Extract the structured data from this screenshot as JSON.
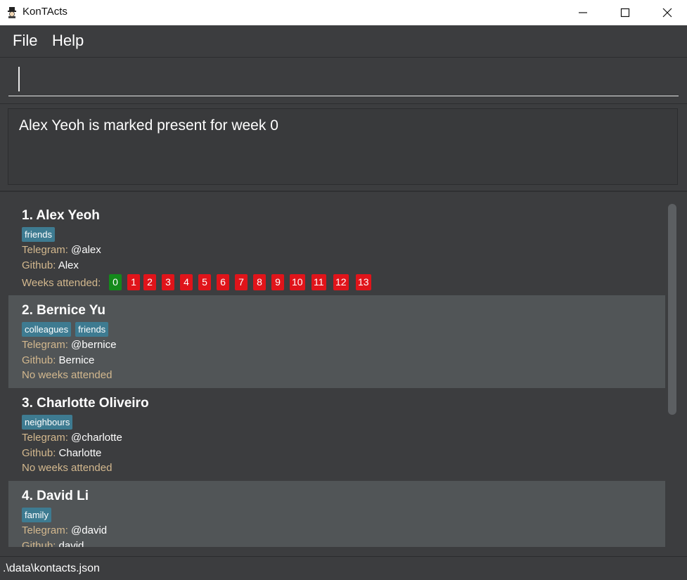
{
  "window": {
    "title": "KonTActs"
  },
  "menu": {
    "file": "File",
    "help": "Help"
  },
  "command": {
    "value": ""
  },
  "result": {
    "text": "Alex Yeoh is marked present for week 0"
  },
  "labels": {
    "telegram": "Telegram: ",
    "github": "Github: ",
    "weeks": "Weeks attended:",
    "no_weeks": "No weeks attended"
  },
  "persons": [
    {
      "name": "1. Alex Yeoh",
      "tags": [
        "friends"
      ],
      "telegram": "@alex",
      "github": "Alex",
      "weeks": [
        {
          "w": "0",
          "status": "present"
        },
        {
          "w": "1",
          "status": "absent"
        },
        {
          "w": "2",
          "status": "absent"
        },
        {
          "w": "3",
          "status": "absent"
        },
        {
          "w": "4",
          "status": "absent"
        },
        {
          "w": "5",
          "status": "absent"
        },
        {
          "w": "6",
          "status": "absent"
        },
        {
          "w": "7",
          "status": "absent"
        },
        {
          "w": "8",
          "status": "absent"
        },
        {
          "w": "9",
          "status": "absent"
        },
        {
          "w": "10",
          "status": "absent"
        },
        {
          "w": "11",
          "status": "absent"
        },
        {
          "w": "12",
          "status": "absent"
        },
        {
          "w": "13",
          "status": "absent"
        }
      ]
    },
    {
      "name": "2. Bernice Yu",
      "tags": [
        "colleagues",
        "friends"
      ],
      "telegram": "@bernice",
      "github": "Bernice",
      "weeks": []
    },
    {
      "name": "3. Charlotte Oliveiro",
      "tags": [
        "neighbours"
      ],
      "telegram": "@charlotte",
      "github": "Charlotte",
      "weeks": []
    },
    {
      "name": "4. David Li",
      "tags": [
        "family"
      ],
      "telegram": "@david",
      "github": "david",
      "weeks": []
    }
  ],
  "colors": {
    "present": "#148a1b",
    "absent": "#e0141a",
    "tag": "#3e7b91",
    "label": "#d3b88e"
  },
  "status": {
    "path": ".\\data\\kontacts.json"
  }
}
